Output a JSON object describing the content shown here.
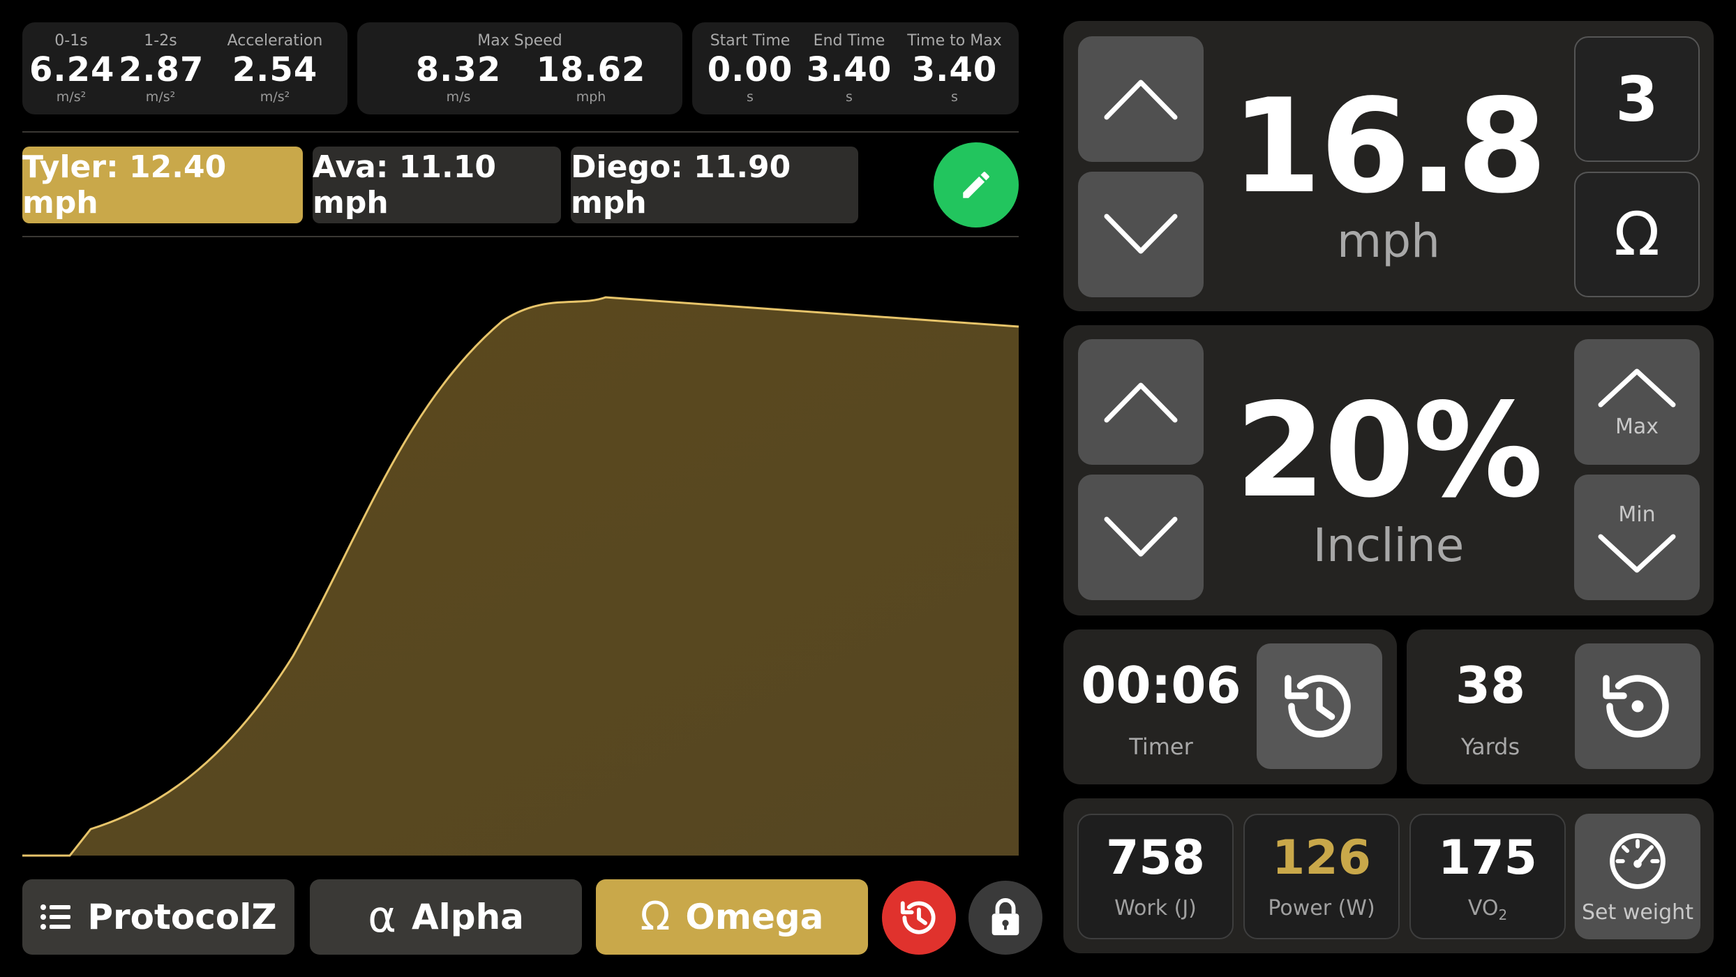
{
  "stats": {
    "group1": [
      {
        "label": "0-1s",
        "value": "6.24",
        "unit": "m/s²"
      },
      {
        "label": "1-2s",
        "value": "2.87",
        "unit": "m/s²"
      },
      {
        "label": "Acceleration",
        "value": "2.54",
        "unit": "m/s²"
      }
    ],
    "group2": {
      "label": "Max Speed",
      "items": [
        {
          "value": "8.32",
          "unit": "m/s"
        },
        {
          "value": "18.62",
          "unit": "mph"
        }
      ]
    },
    "group3": [
      {
        "label": "Start Time",
        "value": "0.00",
        "unit": "s"
      },
      {
        "label": "End Time",
        "value": "3.40",
        "unit": "s"
      },
      {
        "label": "Time to Max",
        "value": "3.40",
        "unit": "s"
      }
    ]
  },
  "athletes": [
    {
      "label": "Tyler: 12.40 mph",
      "active": true
    },
    {
      "label": "Ava: 11.10 mph",
      "active": false
    },
    {
      "label": "Diego: 11.90 mph",
      "active": false
    }
  ],
  "speed": {
    "value": "16.8",
    "unit": "mph",
    "preset": "3",
    "mode_icon": "omega-icon"
  },
  "incline": {
    "value": "20%",
    "label": "Incline",
    "max_label": "Max",
    "min_label": "Min"
  },
  "timer": {
    "value": "00:06",
    "label": "Timer"
  },
  "yards": {
    "value": "38",
    "label": "Yards"
  },
  "metrics": {
    "work": {
      "value": "758",
      "label": "Work (J)"
    },
    "power": {
      "value": "126",
      "label": "Power (W)"
    },
    "vo2": {
      "value": "175",
      "label": "VO",
      "sub": "2"
    },
    "set_weight_label": "Set weight"
  },
  "bottom": {
    "protocol_label": "ProtocolZ",
    "alpha_label": "Alpha",
    "omega_label": "Omega"
  },
  "colors": {
    "accent": "#c9a84a",
    "green": "#22c55e",
    "red": "#e0322d",
    "curve": "#e7c46a"
  }
}
